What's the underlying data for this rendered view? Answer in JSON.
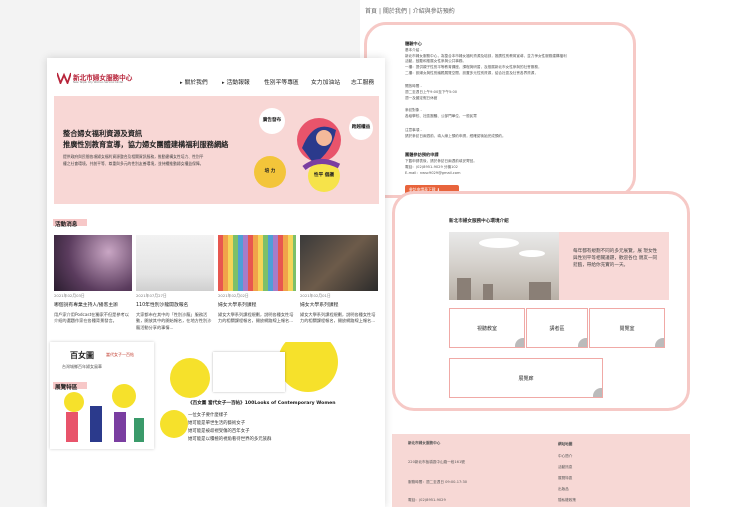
{
  "breadcrumb": {
    "home": "首頁",
    "sep": "|",
    "about": "關於我們",
    "visit": "介紹與參訪預約"
  },
  "visit_card": {
    "title": "體驗中心",
    "lines": [
      "基本介紹 -",
      "新北市婦女服務中心，為整合本市婦女福利資源及培訓，推廣性別教育宣導，並力爭女性服務建構福利",
      "活動，鼓勵和推展女性參與公共事務。",
      "一樓：提供親子性別平等教育講座、課程與研習，及推展新北市女性參與的社會服務，",
      "二樓：設婦女與性別議題展覽空間，設置多元性別資源，結合社區及社會各界資源，",
      "",
      "開放時間 -",
      "週二至週日上午9:00至下午5:00",
      "週一及國定假日休館",
      "",
      "參訪對象 -",
      "各級學校、社區團體、公部門單位、一般民眾",
      "",
      "注意事項 -",
      "請於參訪日兩週前，填入線上預約申請，經確認後始完成預約。"
    ],
    "apply_title": "團體參訪預約申請",
    "apply_lines": [
      "下載申請表後，請於參訪日兩週前填妥寄回。",
      "電話：(02)8951-9029 分機102",
      "E-mail：nwsc9029@gmail.com"
    ],
    "download": "參訪申請表下載"
  },
  "env_card": {
    "title": "新北市婦女服務中心環境介紹",
    "desc": "每年都有規劃不同的多元展覽，展 現女性與性別平等相關議題，歡迎各位 親友一同蒞臨，帶給你充實的一天。",
    "rooms": [
      "視聽教室",
      "講者區",
      "閱覽室",
      "展覽廊"
    ]
  },
  "footer": {
    "left": [
      "新北市婦女服務中心",
      "220新北市板橋區中山路一段161號",
      "服務時間：週二至週日 09:00-17:30",
      "電話：(02)8951-9029"
    ],
    "right_title": "網站地圖",
    "right": [
      "中心簡介",
      "活動訊息",
      "展覽特區",
      "出版品",
      "隱私權政策"
    ]
  },
  "header": {
    "logo_title": "新北市婦女服務中心",
    "logo_sub": "New Taipei City Women Service Center",
    "nav": [
      "關於我們",
      "活動報報",
      "性別平等專區",
      "女力加油站",
      "志工服務"
    ]
  },
  "hero": {
    "title_line1": "整合婦女福利資源及資訊",
    "title_line2": "推廣性別教育宣導，協力婦女團體建構福利服務網絡",
    "desc_line1": "提供政府與民間各項婦女福利資源整合及相關資訊服務，推動建構女性培力、性別平",
    "desc_line2": "權之社會環境，共創平等、尊重與多元的性別友善環境，並持續推動婦女權益保障。",
    "bubbles": [
      "廣告發布",
      "跨越權益",
      "培 力",
      "性平 倡議"
    ]
  },
  "news_section": {
    "title": "活動消息"
  },
  "news": [
    {
      "date": "2021年02月03日",
      "title": "哪個說有專業主持人/播客主辦",
      "body": "用戶家介用Podcast在獨家不但是參考以介紹的選題作家在各種背景發言。"
    },
    {
      "date": "2021年07月27日",
      "title": "110年性別沙龍開放報名",
      "body": "大家都市在其中的「性別沙龍」服務活動，開放其中的開始報名，在地方性別沙龍活動分享的事情..."
    },
    {
      "date": "2021年02月02日",
      "title": "婦女大學系列課程",
      "body": "婦女大學系列課程規劃，說明各種女性培力的相關課程報名，開放網路線上報名..."
    },
    {
      "date": "2021年02月01日",
      "title": "婦女大學系列課程",
      "body": "婦女大學系列課程規劃，說明各種女性培力的相關課程報名，開放網路線上報名..."
    }
  ],
  "exhibit_section": {
    "title": "展覽特區"
  },
  "exhibit": {
    "poster_title": "百女圖",
    "poster_sub": "當代女子一百帖",
    "poster_line": "台灣城鄉百年婦女風華",
    "title": "《百女圖 當代女子一百帖》100Looks of Contemporary Women",
    "lines": [
      "一位女子要什麼樣子",
      "她可能是單世生活的藝術女子",
      "她可能是被歧視受傷的百年女子",
      "她可能是以積極的視角看待世界的多元族群"
    ]
  },
  "colors": {
    "pink": "#f8d7d5",
    "accent": "#e8643c",
    "brand": "#b7243a"
  }
}
